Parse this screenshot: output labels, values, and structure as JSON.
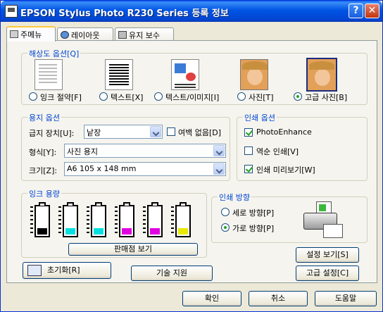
{
  "window": {
    "title": "EPSON Stylus Photo R230 Series 등록 정보",
    "help_glyph": "?",
    "close_glyph": "✕"
  },
  "tabs": [
    {
      "label": "주메뉴",
      "icon": "printer-icon",
      "active": true
    },
    {
      "label": "레이아웃",
      "icon": "layout-icon",
      "active": false
    },
    {
      "label": "유지 보수",
      "icon": "maintenance-icon",
      "active": false
    }
  ],
  "resolution": {
    "title": "해상도 옵션[Q]",
    "options": [
      {
        "label": "잉크 절약[F]",
        "icon": "document-plain-icon",
        "selected": false
      },
      {
        "label": "텍스트[X]",
        "icon": "document-text-icon",
        "selected": false
      },
      {
        "label": "텍스트/이미지[I]",
        "icon": "document-image-icon",
        "selected": false
      },
      {
        "label": "사진[T]",
        "icon": "photo-icon",
        "selected": false
      },
      {
        "label": "고급 사진[B]",
        "icon": "photo-best-icon",
        "selected": true
      }
    ]
  },
  "paper": {
    "title": "용지 옵션",
    "source_label": "급지 장치[U]:",
    "source_value": "낱장",
    "borderless_label": "여백 없음[D]",
    "borderless_checked": false,
    "type_label": "형식[Y]:",
    "type_value": "사진 용지",
    "size_label": "크기[Z]:",
    "size_value": "A6 105 x 148 mm"
  },
  "print_options": {
    "title": "인쇄 옵션",
    "items": [
      {
        "label": "PhotoEnhance",
        "checked": true
      },
      {
        "label": "역순 인쇄[V]",
        "checked": false
      },
      {
        "label": "인쇄 미리보기[W]",
        "checked": true
      }
    ]
  },
  "ink": {
    "title": "잉크 용량",
    "colors": [
      "#000000",
      "#00e0e0",
      "#00e0e0",
      "#e000e0",
      "#e000e0",
      "#e8e800"
    ],
    "dealer_button": "판매점 보기"
  },
  "orientation": {
    "title": "인쇄 방향",
    "portrait_label": "세로 방향[P]",
    "landscape_label": "가로 방향[P]",
    "selected": "landscape"
  },
  "buttons": {
    "reset": "초기화[R]",
    "tech_support": "기술 지원",
    "show_settings": "설정 보기[S]",
    "advanced": "고급 설정[C]",
    "ok": "확인",
    "cancel": "취소",
    "help": "도움말"
  }
}
